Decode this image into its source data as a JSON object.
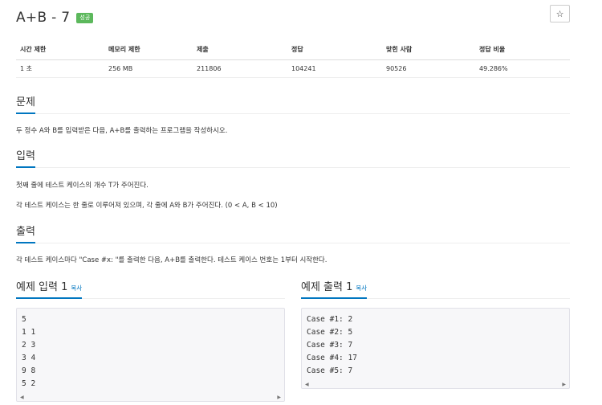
{
  "problem": {
    "title": "A+B - 7",
    "badge": "성공",
    "star_icon": "☆"
  },
  "stats": {
    "headers": [
      "시간 제한",
      "메모리 제한",
      "제출",
      "정답",
      "맞힌 사람",
      "정답 비율"
    ],
    "values": [
      "1 초",
      "256 MB",
      "211806",
      "104241",
      "90526",
      "49.286%"
    ]
  },
  "sections": {
    "description": {
      "title": "문제",
      "text": "두 정수 A와 B를 입력받은 다음, A+B를 출력하는 프로그램을 작성하시오."
    },
    "input": {
      "title": "입력",
      "line1": "첫째 줄에 테스트 케이스의 개수 T가 주어진다.",
      "line2": "각 테스트 케이스는 한 줄로 이루어져 있으며, 각 줄에 A와 B가 주어진다. (0 < A, B < 10)"
    },
    "output": {
      "title": "출력",
      "text": "각 테스트 케이스마다 \"Case #x: \"를 출력한 다음, A+B를 출력한다. 테스트 케이스 번호는 1부터 시작한다."
    }
  },
  "samples": {
    "input": {
      "title": "예제 입력 1",
      "copy_label": "복사",
      "lines": [
        "5",
        "1 1",
        "2 3",
        "3 4",
        "9 8",
        "5 2"
      ]
    },
    "output": {
      "title": "예제 출력 1",
      "copy_label": "복사",
      "lines": [
        "Case #1: 2",
        "Case #2: 5",
        "Case #3: 7",
        "Case #4: 17",
        "Case #5: 7"
      ]
    },
    "scroll_left_icon": "◀",
    "scroll_right_icon": "▶"
  }
}
